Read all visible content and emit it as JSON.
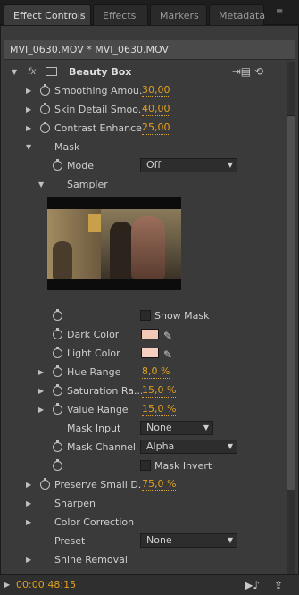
{
  "tabs": [
    {
      "label": "Effect Controls",
      "close": "×"
    },
    {
      "label": "Effects"
    },
    {
      "label": "Markers"
    },
    {
      "label": "Metadata"
    }
  ],
  "panel_menu_icon": "≡",
  "clip_title": "MVI_0630.MOV * MVI_0630.MOV",
  "effect": {
    "fx_label": "fx",
    "name": "Beauty Box"
  },
  "params": {
    "smoothing": {
      "label": "Smoothing Amou...",
      "value": "30,00"
    },
    "skin_detail": {
      "label": "Skin Detail Smoo...",
      "value": "40,00"
    },
    "contrast": {
      "label": "Contrast Enhance",
      "value": "25,00"
    },
    "mask": {
      "label": "Mask"
    },
    "mode": {
      "label": "Mode",
      "value": "Off"
    },
    "sampler": {
      "label": "Sampler"
    },
    "show_mask": {
      "label": "Show Mask"
    },
    "dark_color": {
      "label": "Dark Color",
      "swatch": "#f2c9b6"
    },
    "light_color": {
      "label": "Light Color",
      "swatch": "#f5cfc0"
    },
    "hue_range": {
      "label": "Hue Range",
      "value": "8,0 %"
    },
    "saturation_range": {
      "label": "Saturation Ra...",
      "value": "15,0 %"
    },
    "value_range": {
      "label": "Value Range",
      "value": "15,0 %"
    },
    "mask_input": {
      "label": "Mask Input",
      "value": "None"
    },
    "mask_channel": {
      "label": "Mask Channel",
      "value": "Alpha"
    },
    "mask_invert": {
      "label": "Mask Invert"
    },
    "preserve_small": {
      "label": "Preserve Small D...",
      "value": "75,0 %"
    },
    "sharpen": {
      "label": "Sharpen"
    },
    "color_correction": {
      "label": "Color Correction"
    },
    "preset": {
      "label": "Preset",
      "value": "None"
    },
    "shine_removal": {
      "label": "Shine Removal"
    }
  },
  "footer": {
    "timecode": "00:00:48:15"
  },
  "colors": {
    "accent_value": "#e0a020",
    "panel_bg": "#3a3a3a"
  }
}
